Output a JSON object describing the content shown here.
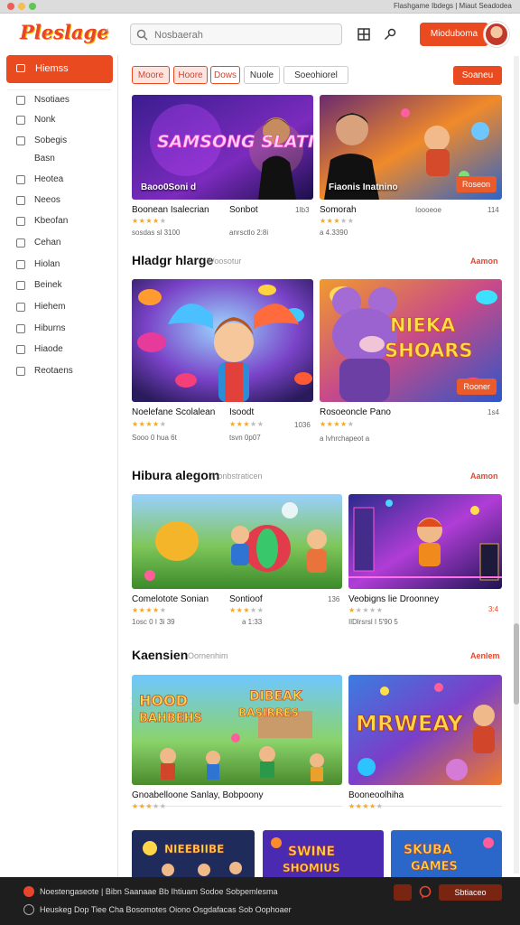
{
  "window": {
    "title_left": "Flashgame",
    "title_right": "Ibdegs | Miaut Seadodea"
  },
  "header": {
    "logo": "Pleslage",
    "logo_extra": "×",
    "search_placeholder": "Nosbaerah",
    "cta_label": "Mioduboma",
    "accent": "#ea4a20"
  },
  "sidebar": {
    "active_label": "Hiemss",
    "items": [
      {
        "label": "Nsotiaes",
        "icon": "circle-icon"
      },
      {
        "label": "Nonk",
        "icon": "circle-icon"
      },
      {
        "label": "Sobegis",
        "icon": "grid-icon"
      },
      {
        "label": "Basn",
        "icon": ""
      },
      {
        "label": "Heotea",
        "icon": "box-icon"
      },
      {
        "label": "Neeos",
        "icon": "circle-icon"
      },
      {
        "label": "Kbeofan",
        "icon": "grid-icon"
      },
      {
        "label": "Cehan",
        "icon": "leaf-icon"
      },
      {
        "label": "Hiolan",
        "icon": "box-icon"
      },
      {
        "label": "Beinek",
        "icon": "box-icon"
      },
      {
        "label": "Hiehem",
        "icon": "box-icon"
      },
      {
        "label": "Hiburns",
        "icon": "box-icon"
      },
      {
        "label": "Hiaode",
        "icon": "circle-icon"
      },
      {
        "label": "Reotaens",
        "icon": "box-icon"
      }
    ]
  },
  "filters": {
    "chips": [
      "Moore",
      "Hoore",
      "Dows",
      "Nuole",
      "Soeohiorel"
    ],
    "action": "Soaneu"
  },
  "featured": [
    {
      "overlay": "Baoo0Soni d",
      "art": "SAMSONG SLATIIH",
      "title": "Boonean Isalecrian",
      "extra": "Sonbot",
      "year": "1Ib3",
      "rating": 4,
      "meta": "sosdas sl 3100",
      "meta2": "anrsctlo 2:8i"
    },
    {
      "overlay": "Fiaonis Inatnino",
      "button": "Roseon",
      "title": "Somorah",
      "extra": "Ioooeoe",
      "year": "114",
      "rating": 3,
      "meta": "a 4.3390",
      "meta2": ""
    }
  ],
  "sections": [
    {
      "title": "Hladgr hlarge",
      "subtitle": "Woosotur",
      "link": "Aamon",
      "cards": [
        {
          "title": "Noelefane Scolalean",
          "extra": "Isoodt",
          "year": "1036",
          "rating": 4,
          "meta": "Sooo 0 hua 6t",
          "meta2": "tsvn 0p07",
          "art": ""
        },
        {
          "title": "Rosoeoncle Pano",
          "year": "1s4",
          "rating": 4,
          "meta": "a Ivhrchapeot a",
          "button": "Rooner",
          "art": "NIEKA SHOARS"
        }
      ]
    },
    {
      "title": "Hibura alegom",
      "subtitle": "Inonbstraticen",
      "link": "Aamon",
      "cards": [
        {
          "title": "Comelotote Sonian",
          "extra": "Sontioof",
          "year": "136",
          "rating": 4,
          "meta": "1osc 0 I 3i 39",
          "meta2": "a 1:33"
        },
        {
          "title": "Veobigns lie Droonney",
          "year": "3:4",
          "rating": 1,
          "meta": "IlDlrsrsl I 5'90 5"
        }
      ]
    },
    {
      "title": "Kaensien",
      "subtitle": "Oornenhim",
      "link": "Aenlem",
      "cards": [
        {
          "title": "Gnoabelloone Sanlay, Bobpoony",
          "rating": 3,
          "art": "HOOD BAHBEHS / DIBEAK BASIRRES"
        },
        {
          "title": "Booneoolhiha",
          "rating": 4,
          "art": "MRWEAY"
        }
      ]
    }
  ],
  "bottom_row": [
    {
      "art": "NIEEBIIBE"
    },
    {
      "art": "SWINE SHOMIUS"
    },
    {
      "art": "SKUBA GAMES"
    }
  ],
  "footer": {
    "row1": "Noestengaseote | Bibn  Saanaae  Bb  Ihtiuam  Sodoe  Sobpemlesma",
    "row2": "Heuskeg Dop Tiee Cha  Bosomotes  Oiono  Osgdafacas Sob Oophoaer",
    "cta": "Sbtiaceo"
  }
}
